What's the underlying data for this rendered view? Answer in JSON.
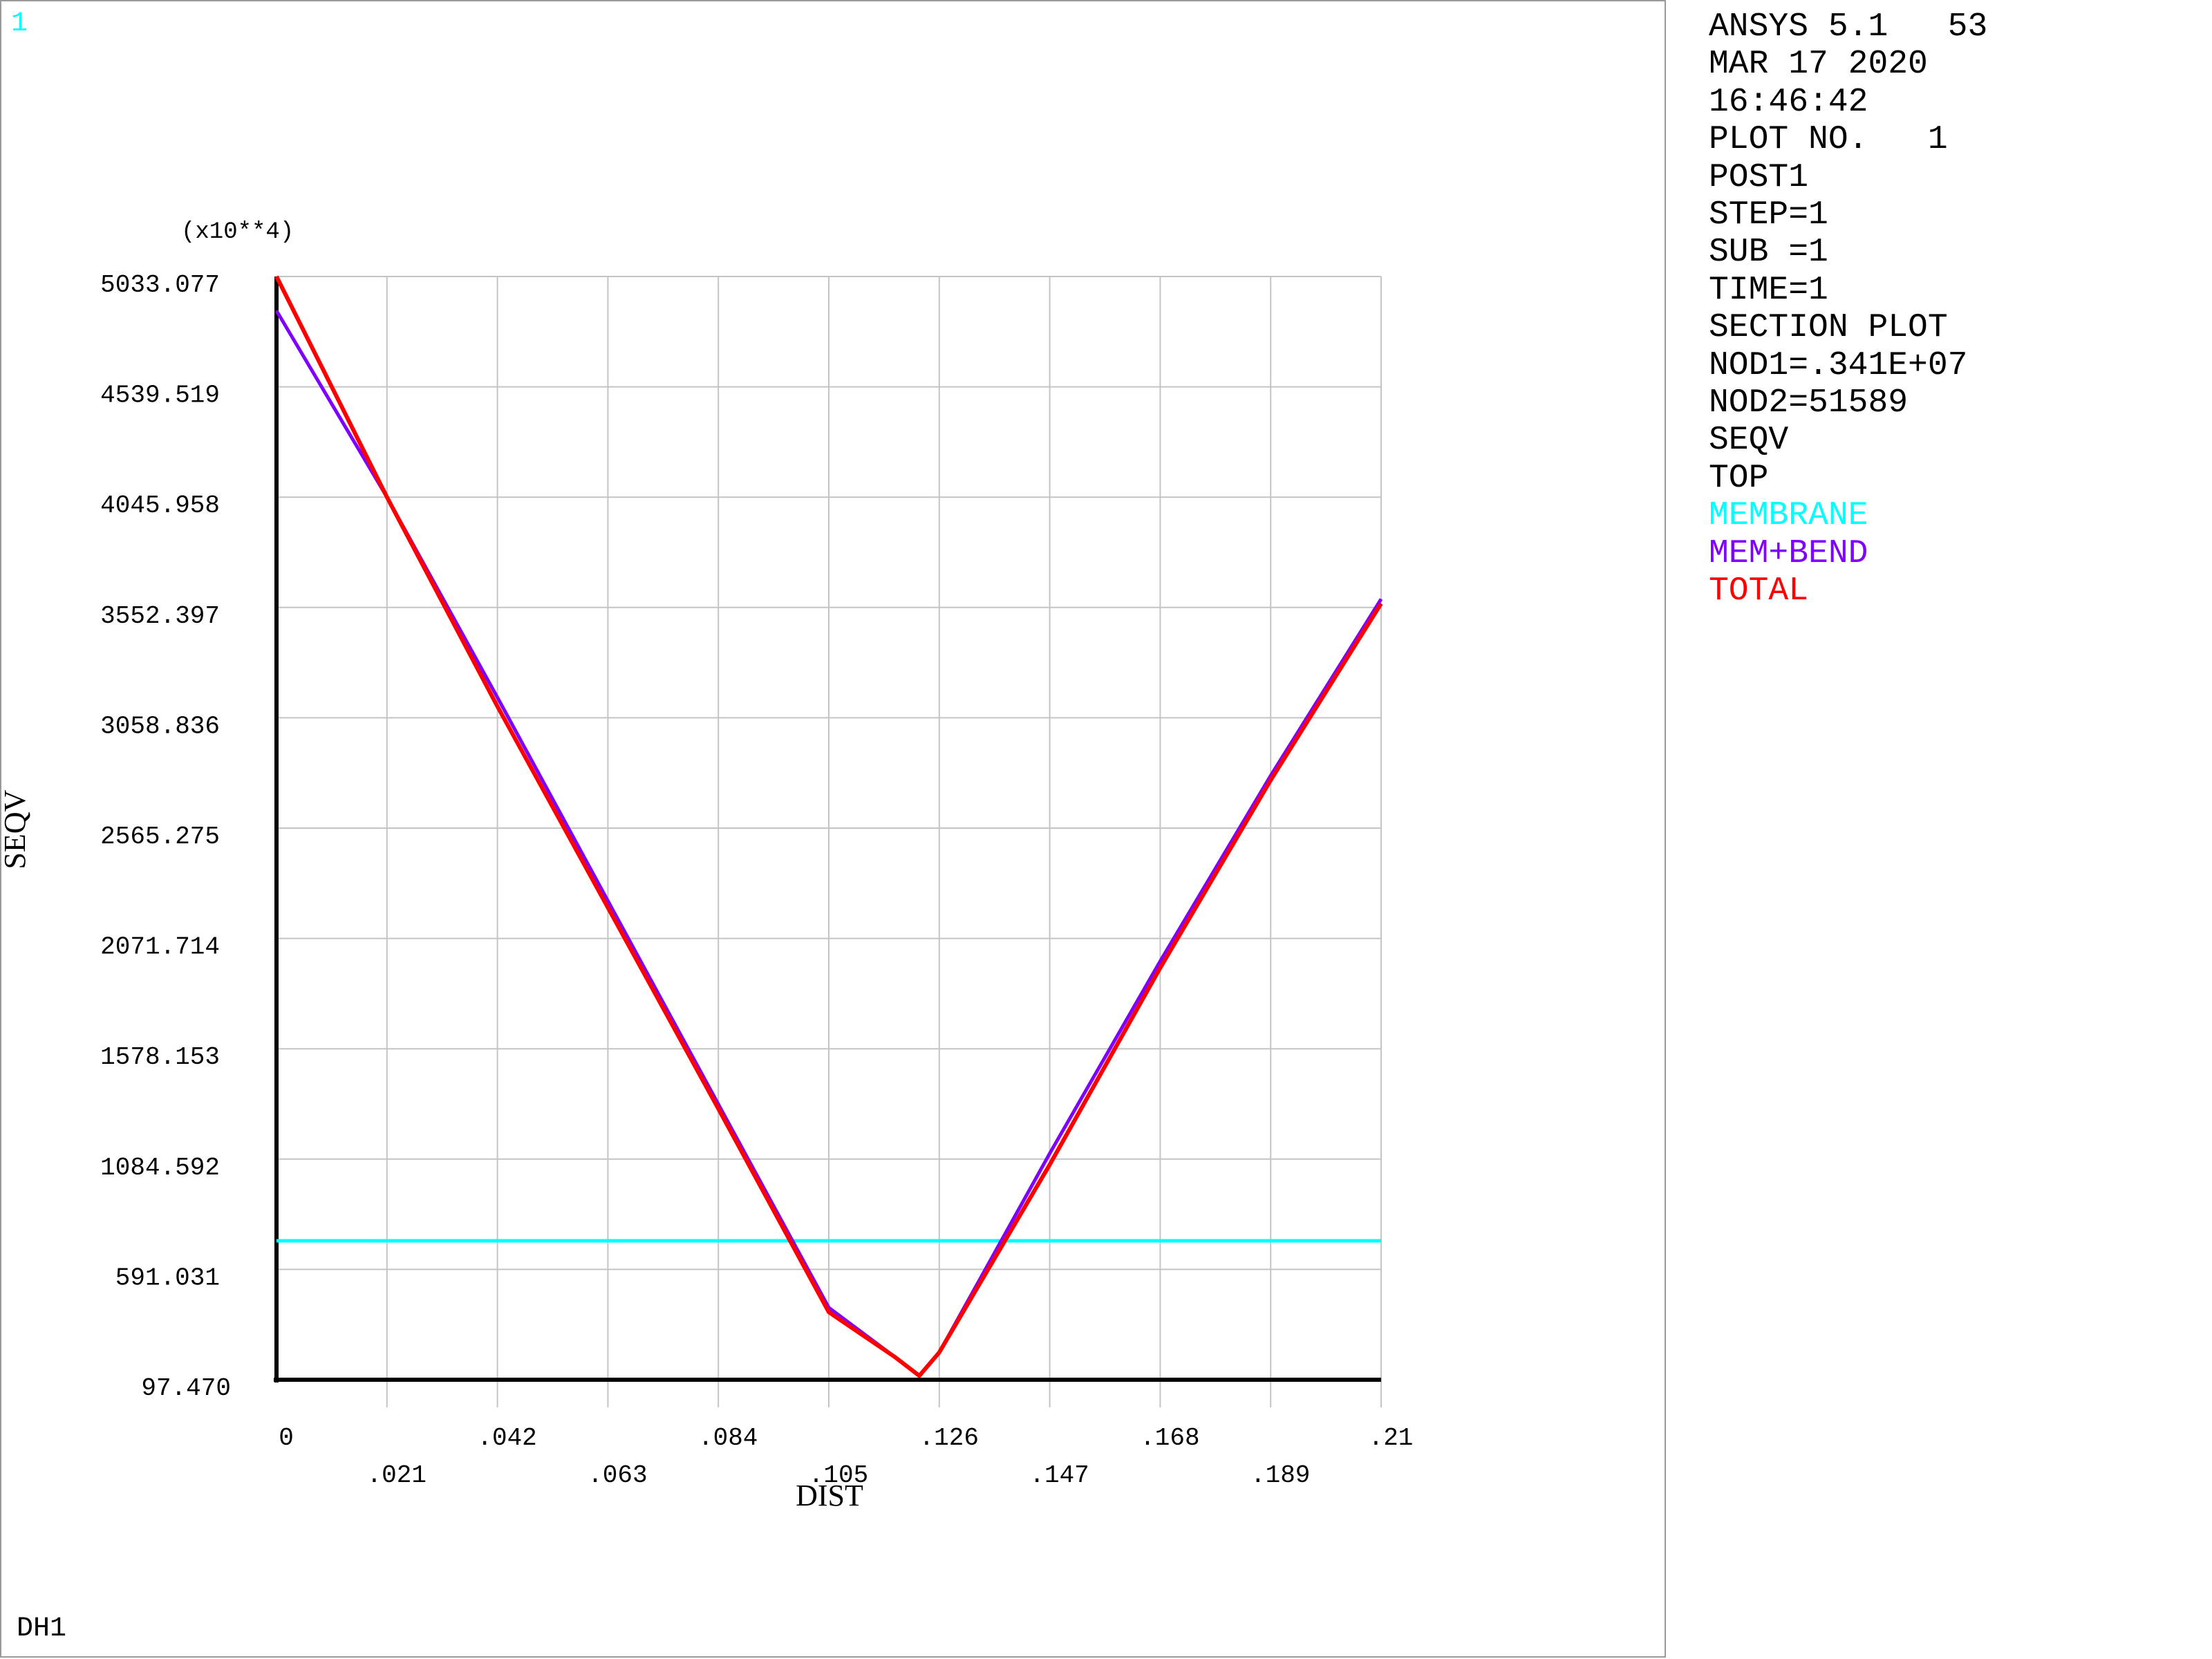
{
  "window": {
    "number": "1",
    "label": "DH1"
  },
  "header": {
    "lines": [
      "ANSYS 5.1   53",
      "MAR 17 2020",
      "16:46:42",
      "PLOT NO.   1",
      "POST1",
      "STEP=1",
      "SUB =1",
      "TIME=1",
      "SECTION PLOT",
      "NOD1=.341E+07",
      "NOD2=51589",
      "SEQV",
      "TOP"
    ],
    "legend": [
      {
        "label": "MEMBRANE",
        "color": "#00ffff"
      },
      {
        "label": "MEM+BEND",
        "color": "#8000ff"
      },
      {
        "label": "TOTAL",
        "color": "#ff0000"
      }
    ]
  },
  "chart_data": {
    "type": "line",
    "xlabel": "DIST",
    "ylabel": "SEQV",
    "y_multiplier_label": "(x10**4)",
    "xlim": [
      0,
      0.21
    ],
    "ylim": [
      97.47,
      5033.077
    ],
    "x_ticks": [
      0,
      0.021,
      0.042,
      0.063,
      0.084,
      0.105,
      0.126,
      0.147,
      0.168,
      0.189,
      0.21
    ],
    "x_tick_labels": [
      "0",
      ".021",
      ".042",
      ".063",
      ".084",
      ".105",
      ".126",
      ".147",
      ".168",
      ".189",
      ".21"
    ],
    "y_ticks": [
      97.47,
      591.031,
      1084.592,
      1578.153,
      2071.714,
      2565.275,
      3058.836,
      3552.397,
      4045.958,
      4539.519,
      5033.077
    ],
    "y_tick_labels": [
      "97.470",
      "591.031",
      "1084.592",
      "1578.153",
      "2071.714",
      "2565.275",
      "3058.836",
      "3552.397",
      "4045.958",
      "4539.519",
      "5033.077"
    ],
    "grid": true,
    "series": [
      {
        "name": "MEMBRANE",
        "color": "#00ffff",
        "x": [
          0,
          0.21
        ],
        "y": [
          719,
          719
        ]
      },
      {
        "name": "MEM+BEND",
        "color": "#8000ff",
        "x": [
          0,
          0.021,
          0.042,
          0.063,
          0.084,
          0.105,
          0.1175,
          0.1222,
          0.126,
          0.147,
          0.168,
          0.189,
          0.21
        ],
        "y": [
          4880,
          4046,
          3150,
          2240,
          1330,
          420,
          200,
          115,
          220,
          1110,
          1970,
          2800,
          3590
        ]
      },
      {
        "name": "TOTAL",
        "color": "#ff0000",
        "x": [
          0,
          0.021,
          0.042,
          0.063,
          0.084,
          0.105,
          0.1175,
          0.1222,
          0.126,
          0.147,
          0.168,
          0.189,
          0.21
        ],
        "y": [
          5033,
          4046,
          3110,
          2210,
          1310,
          400,
          200,
          115,
          220,
          1060,
          1940,
          2780,
          3570
        ]
      }
    ]
  }
}
